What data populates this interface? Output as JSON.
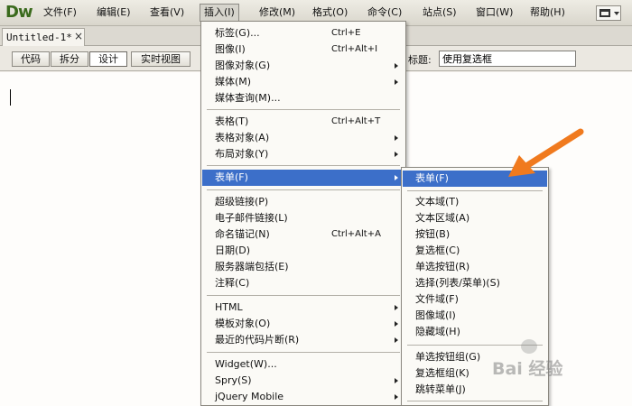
{
  "app": {
    "logo": "Dw"
  },
  "menubar": {
    "items": [
      "文件(F)",
      "编辑(E)",
      "查看(V)",
      "插入(I)",
      "修改(M)",
      "格式(O)",
      "命令(C)",
      "站点(S)",
      "窗口(W)",
      "帮助(H)"
    ],
    "active": "插入(I)"
  },
  "layout_switch": {
    "icon": "layout-icon"
  },
  "document_tab": {
    "label": "Untitled-1*",
    "close": "×"
  },
  "toolbar": {
    "views": [
      "代码",
      "拆分",
      "设计",
      "实时视图"
    ],
    "selected_view": "设计",
    "title_label": "标题:",
    "title_value": "使用复选框"
  },
  "insert_menu": {
    "items": [
      {
        "label": "标签(G)...",
        "shortcut": "Ctrl+E"
      },
      {
        "label": "图像(I)",
        "shortcut": "Ctrl+Alt+I"
      },
      {
        "label": "图像对象(G)",
        "submenu": true
      },
      {
        "label": "媒体(M)",
        "submenu": true
      },
      {
        "label": "媒体查询(M)..."
      },
      {
        "separator": true
      },
      {
        "label": "表格(T)",
        "shortcut": "Ctrl+Alt+T"
      },
      {
        "label": "表格对象(A)",
        "submenu": true
      },
      {
        "label": "布局对象(Y)",
        "submenu": true
      },
      {
        "separator": true
      },
      {
        "label": "表单(F)",
        "submenu": true,
        "highlighted": true
      },
      {
        "separator": true
      },
      {
        "label": "超级链接(P)"
      },
      {
        "label": "电子邮件链接(L)"
      },
      {
        "label": "命名锚记(N)",
        "shortcut": "Ctrl+Alt+A"
      },
      {
        "label": "日期(D)"
      },
      {
        "label": "服务器端包括(E)"
      },
      {
        "label": "注释(C)"
      },
      {
        "separator": true
      },
      {
        "label": "HTML",
        "submenu": true
      },
      {
        "label": "模板对象(O)",
        "submenu": true
      },
      {
        "label": "最近的代码片断(R)",
        "submenu": true
      },
      {
        "separator": true
      },
      {
        "label": "Widget(W)..."
      },
      {
        "label": "Spry(S)",
        "submenu": true
      },
      {
        "label": "jQuery Mobile",
        "submenu": true
      }
    ]
  },
  "form_submenu": {
    "items": [
      {
        "label": "表单(F)",
        "highlighted": true
      },
      {
        "separator": true
      },
      {
        "label": "文本域(T)"
      },
      {
        "label": "文本区域(A)"
      },
      {
        "label": "按钮(B)"
      },
      {
        "label": "复选框(C)"
      },
      {
        "label": "单选按钮(R)"
      },
      {
        "label": "选择(列表/菜单)(S)"
      },
      {
        "label": "文件域(F)"
      },
      {
        "label": "图像域(I)"
      },
      {
        "label": "隐藏域(H)"
      },
      {
        "separator": true
      },
      {
        "label": "单选按钮组(G)"
      },
      {
        "label": "复选框组(K)"
      },
      {
        "label": "跳转菜单(J)"
      },
      {
        "separator": true
      }
    ]
  },
  "annotation": {
    "arrow_color": "#f07a1e"
  },
  "watermark": {
    "text": "Bai 经验"
  }
}
